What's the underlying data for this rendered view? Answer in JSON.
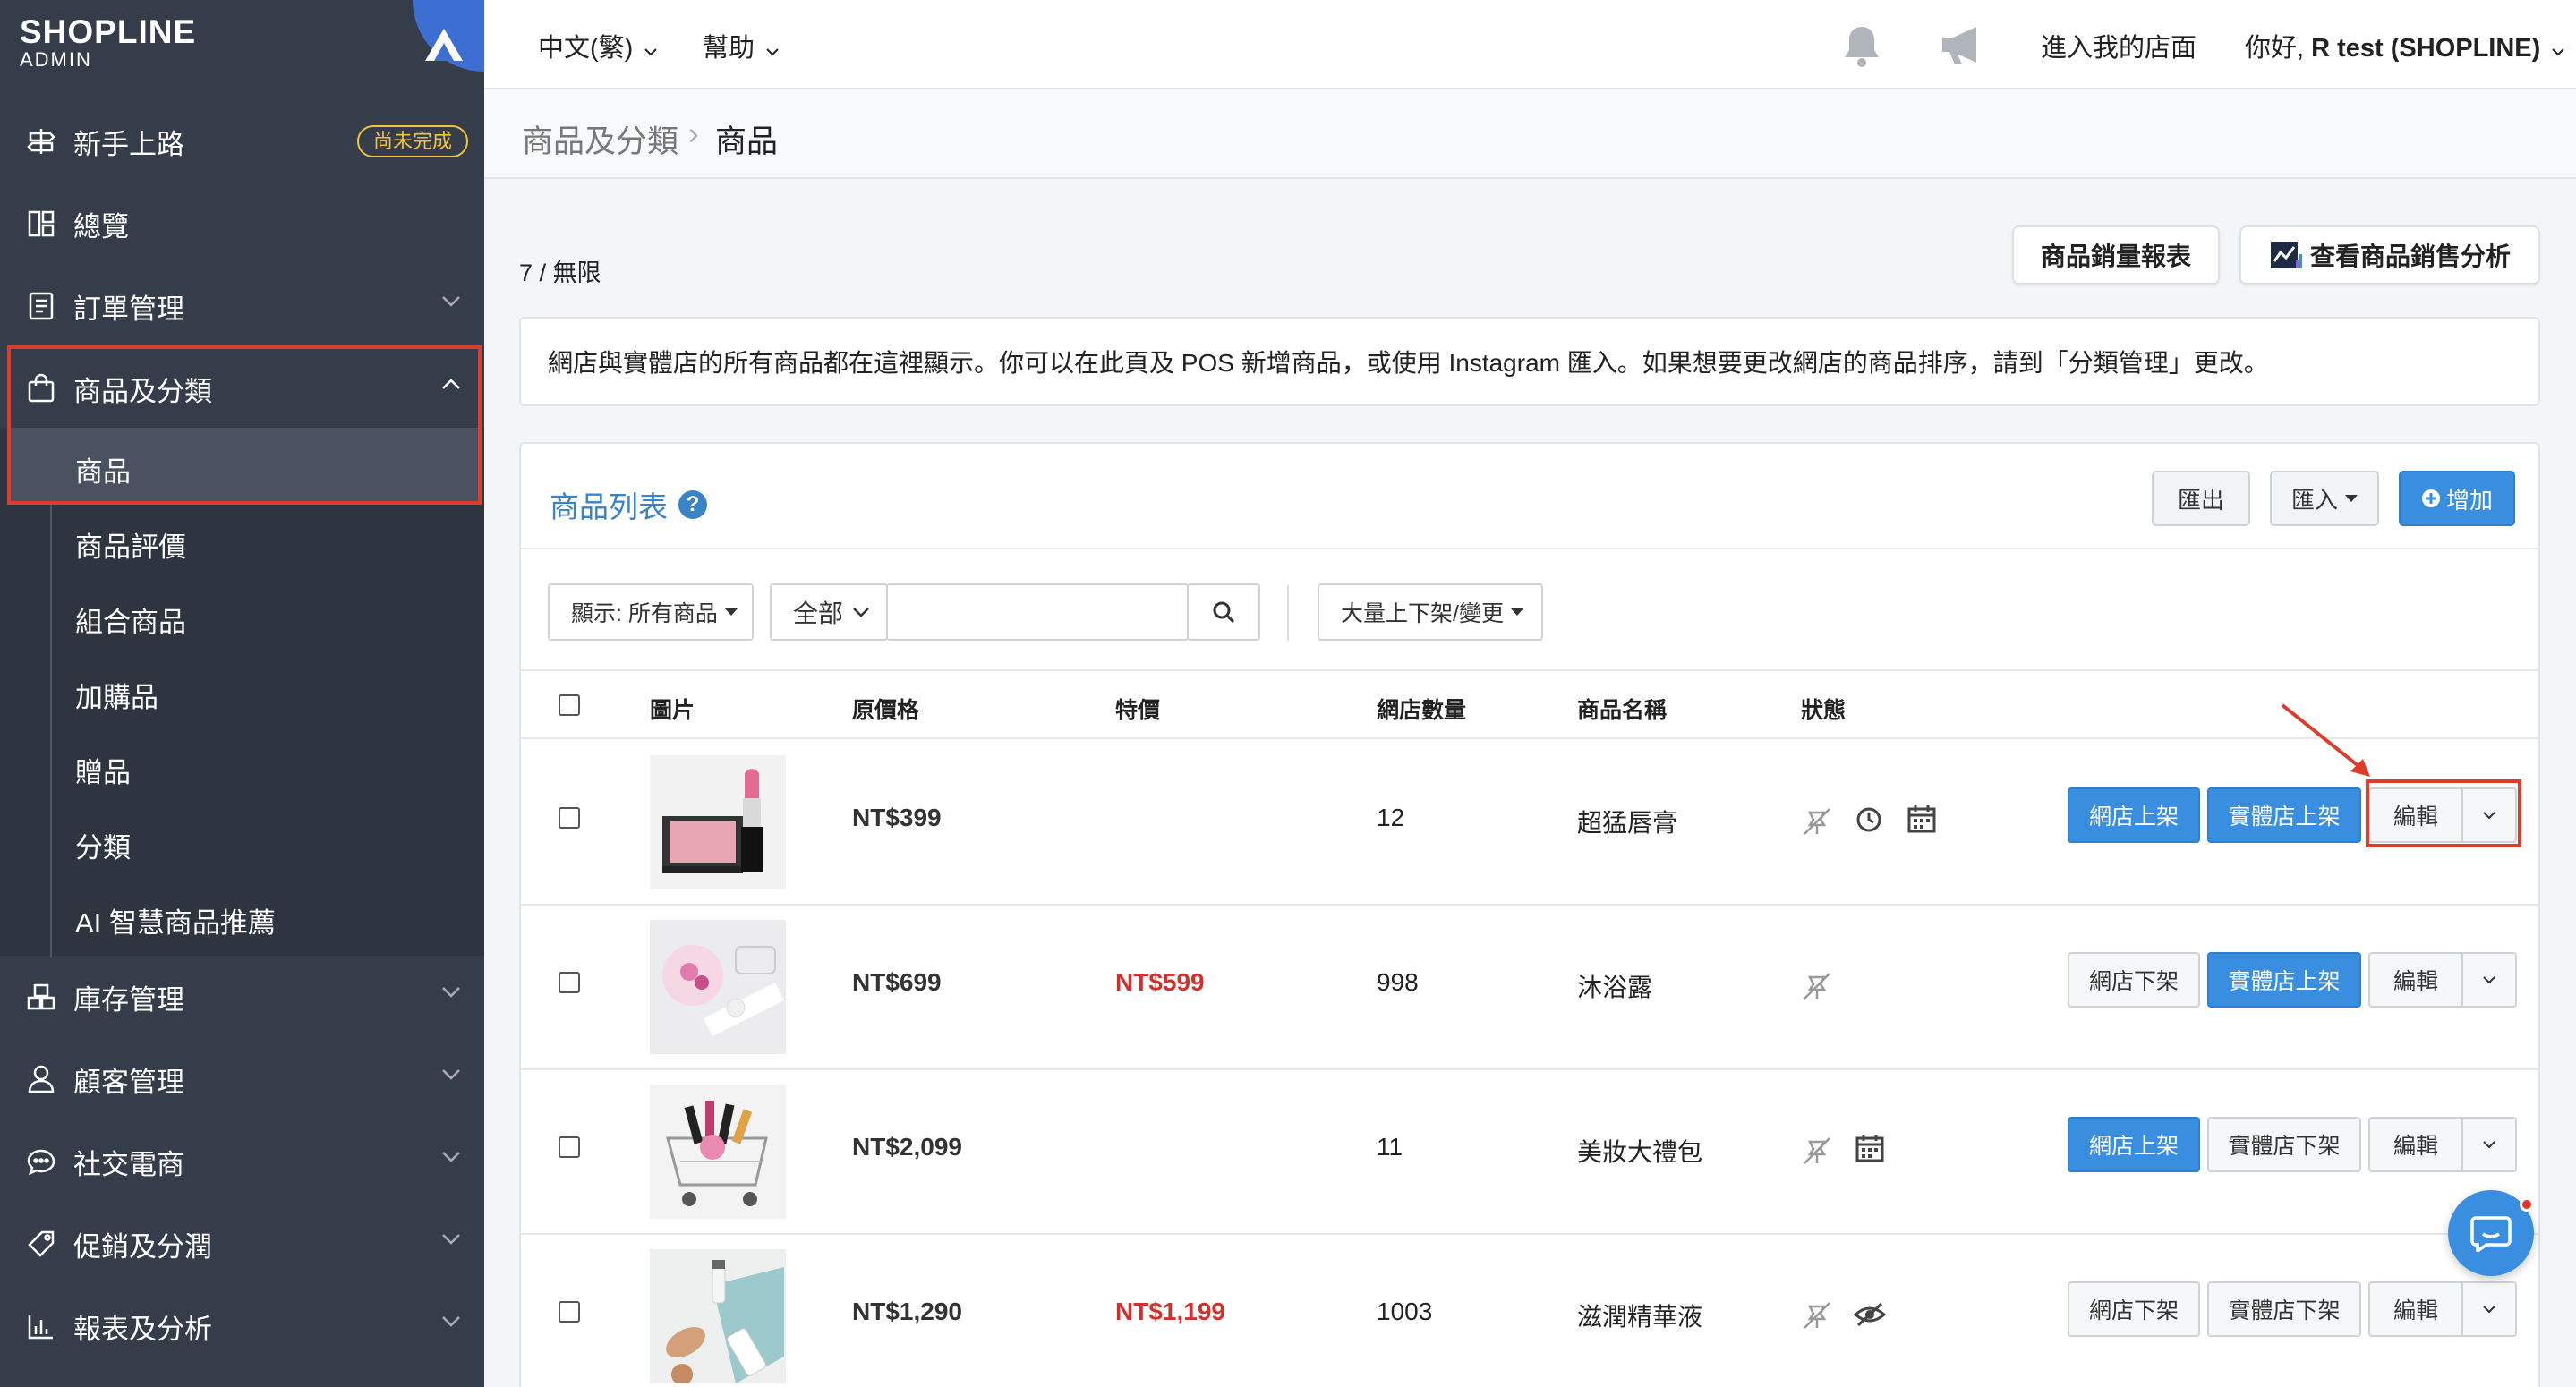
{
  "sidebar": {
    "brand": "SHOPLINE",
    "sub": "ADMIN",
    "items": [
      {
        "label": "新手上路",
        "icon": "signpost-icon",
        "badge": "尚未完成"
      },
      {
        "label": "總覽",
        "icon": "dashboard-icon"
      },
      {
        "label": "訂單管理",
        "icon": "order-icon"
      },
      {
        "label": "商品及分類",
        "icon": "shopping-bag-icon"
      },
      {
        "label": "庫存管理",
        "icon": "inventory-icon"
      },
      {
        "label": "顧客管理",
        "icon": "user-icon"
      },
      {
        "label": "社交電商",
        "icon": "chat-bubble-icon"
      },
      {
        "label": "促銷及分潤",
        "icon": "tag-icon"
      },
      {
        "label": "報表及分析",
        "icon": "report-icon"
      }
    ],
    "subitems": [
      "商品",
      "商品評價",
      "組合商品",
      "加購品",
      "贈品",
      "分類",
      "AI 智慧商品推薦"
    ]
  },
  "topbar": {
    "language": "中文(繁)",
    "help": "幫助",
    "store_link": "進入我的店面",
    "greeting_prefix": "你好, ",
    "greeting_name": "R test (SHOPLINE)"
  },
  "breadcrumb": {
    "parent": "商品及分類",
    "sep": "›",
    "current": "商品"
  },
  "count": "7 / 無限",
  "report_button": "商品銷量報表",
  "analysis_button": "查看商品銷售分析",
  "info": "網店與實體店的所有商品都在這裡顯示。你可以在此頁及 POS 新增商品，或使用 Instagram 匯入。如果想要更改網店的商品排序，請到「分類管理」更改。",
  "panel": {
    "title": "商品列表",
    "help": "?",
    "export": "匯出",
    "import": "匯入",
    "add": "增加",
    "filter_display": "顯示: 所有商品",
    "filter_scope": "全部",
    "search_placeholder": "",
    "bulk": "大量上下架/變更"
  },
  "table": {
    "headers": [
      "圖片",
      "原價格",
      "特價",
      "網店數量",
      "商品名稱",
      "狀態"
    ],
    "rows": [
      {
        "price": "NT$399",
        "sale": "",
        "qty": "12",
        "name": "超猛唇膏",
        "online": "網店上架",
        "online_style": "blue",
        "store": "實體店上架",
        "store_style": "blue",
        "edit": "編輯"
      },
      {
        "price": "NT$699",
        "sale": "NT$599",
        "qty": "998",
        "name": "沐浴露",
        "online": "網店下架",
        "online_style": "grey",
        "store": "實體店上架",
        "store_style": "blue",
        "edit": "編輯"
      },
      {
        "price": "NT$2,099",
        "sale": "",
        "qty": "11",
        "name": "美妝大禮包",
        "online": "網店上架",
        "online_style": "blue",
        "store": "實體店下架",
        "store_style": "grey",
        "edit": "編輯"
      },
      {
        "price": "NT$1,290",
        "sale": "NT$1,199",
        "qty": "1003",
        "name": "滋潤精華液",
        "online": "網店下架",
        "online_style": "grey",
        "store": "實體店下架",
        "store_style": "grey",
        "edit": "編輯"
      }
    ]
  },
  "colors": {
    "sidebar": "#363d4a",
    "accent": "#3a8ee0",
    "highlight": "#e03b2a",
    "sale": "#d0312d"
  }
}
